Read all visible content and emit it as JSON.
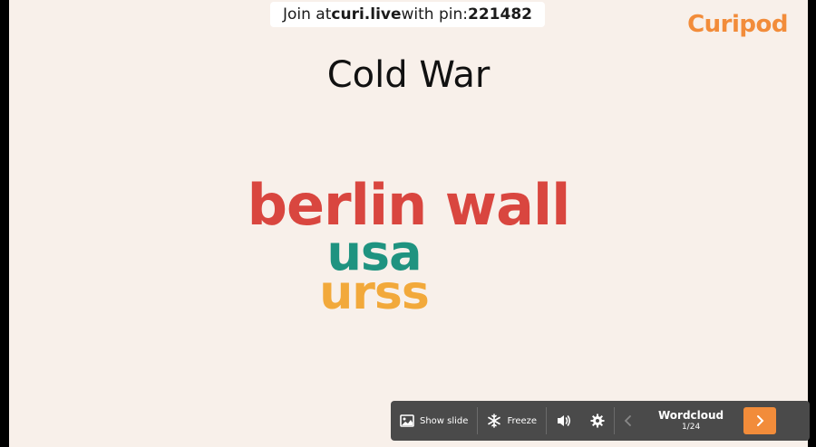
{
  "header": {
    "join_prefix": "Join at ",
    "join_site": "curi.live",
    "join_middle": " with pin: ",
    "pin": "221482"
  },
  "brand": {
    "logo_text": "Curipod",
    "accent_color": "#f28c3a"
  },
  "slide": {
    "title": "Cold War"
  },
  "wordcloud": {
    "words": [
      {
        "text": "berlin wall",
        "color": "#d9463f"
      },
      {
        "text": "usa",
        "color": "#1f9380"
      },
      {
        "text": "urss",
        "color": "#f2a93b"
      }
    ]
  },
  "toolbar": {
    "show_slide_label": "Show slide",
    "freeze_label": "Freeze",
    "slide_type": "Wordcloud",
    "slide_position": "1/24",
    "icons": [
      "image-icon",
      "snowflake-icon",
      "speaker-icon",
      "gear-icon",
      "chevron-left-icon",
      "chevron-right-icon"
    ]
  }
}
